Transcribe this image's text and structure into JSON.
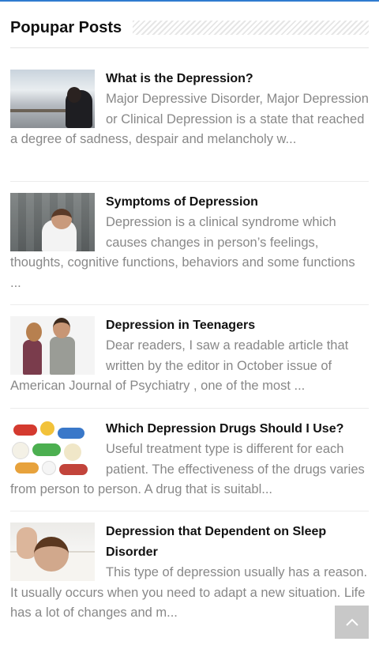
{
  "widget": {
    "title": "Popupar Posts"
  },
  "posts": [
    {
      "title": "What is the Depression?",
      "excerpt": "Major Depressive Disorder, Major Depression or Clinical Depression is a state that reached a degree of sadness, despair and melancholy w...",
      "thumb_icon": "person-sitting-alone-image"
    },
    {
      "title": "Symptoms of Depression",
      "excerpt": "Depression is a clinical syndrome which causes changes in person’s feelings, thoughts, cognitive functions, behaviors and some functions ...",
      "thumb_icon": "woman-holding-head-image"
    },
    {
      "title": "Depression in Teenagers",
      "excerpt": "Dear readers, I saw a readable article that written by the editor in October issue of American Journal of Psychiatry , one of the most ...",
      "thumb_icon": "teen-couple-back-to-back-image"
    },
    {
      "title": "Which Depression Drugs Should I Use?",
      "excerpt": "Useful treatment type is different for each patient. The effectiveness of the drugs varies from person to person. A drug that is suitabl...",
      "thumb_icon": "pills-image"
    },
    {
      "title": "Depression that Dependent on Sleep Disorder",
      "excerpt": "This type of depression usually has a reason. It usually occurs when you need to adapt a new situation. Life has a lot of changes and m...",
      "thumb_icon": "sleepless-man-image"
    }
  ],
  "back_to_top_icon": "chevron-up-icon",
  "colors": {
    "accent": "#2f7bd0",
    "title_text": "#111111",
    "excerpt_text": "#888888",
    "back_to_top_bg": "#c8c8c8"
  }
}
